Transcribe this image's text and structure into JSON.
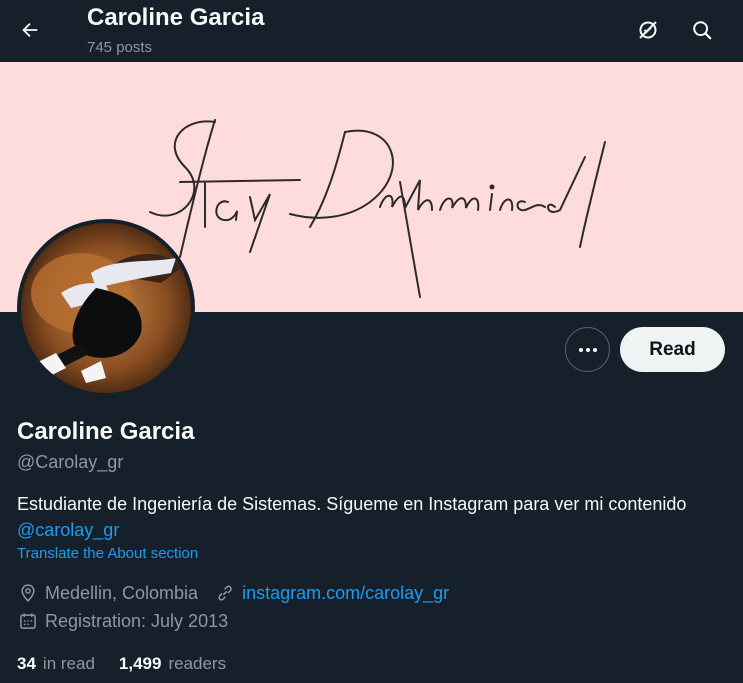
{
  "header": {
    "title": "Caroline Garcia",
    "post_count": "745 posts",
    "icons": [
      "back-arrow-icon",
      "no-network-icon",
      "search-icon"
    ]
  },
  "banner": {
    "color": "#ffdcdc",
    "script_text": "Stay Determined"
  },
  "profile": {
    "name": "Caroline Garcia",
    "handle": "@Carolay_gr",
    "bio": "Estudiante de Ingeniería de Sistemas. Sígueme en Instagram para ver mi contenido",
    "bio_mention": "@carolay_gr",
    "translate_label": "Translate the About section",
    "location": "Medellin, Colombia",
    "website": "instagram.com/carolay_gr",
    "registration": "Registration: July 2013"
  },
  "actions": {
    "read_label": "Read"
  },
  "stats": {
    "in_read_count": "34",
    "in_read_label": "in read",
    "readers_count": "1,499",
    "readers_label": "readers"
  },
  "colors": {
    "background": "#15202b",
    "accent": "#1d9bf0",
    "muted": "#8b98a5",
    "text": "#f7f9f9"
  }
}
